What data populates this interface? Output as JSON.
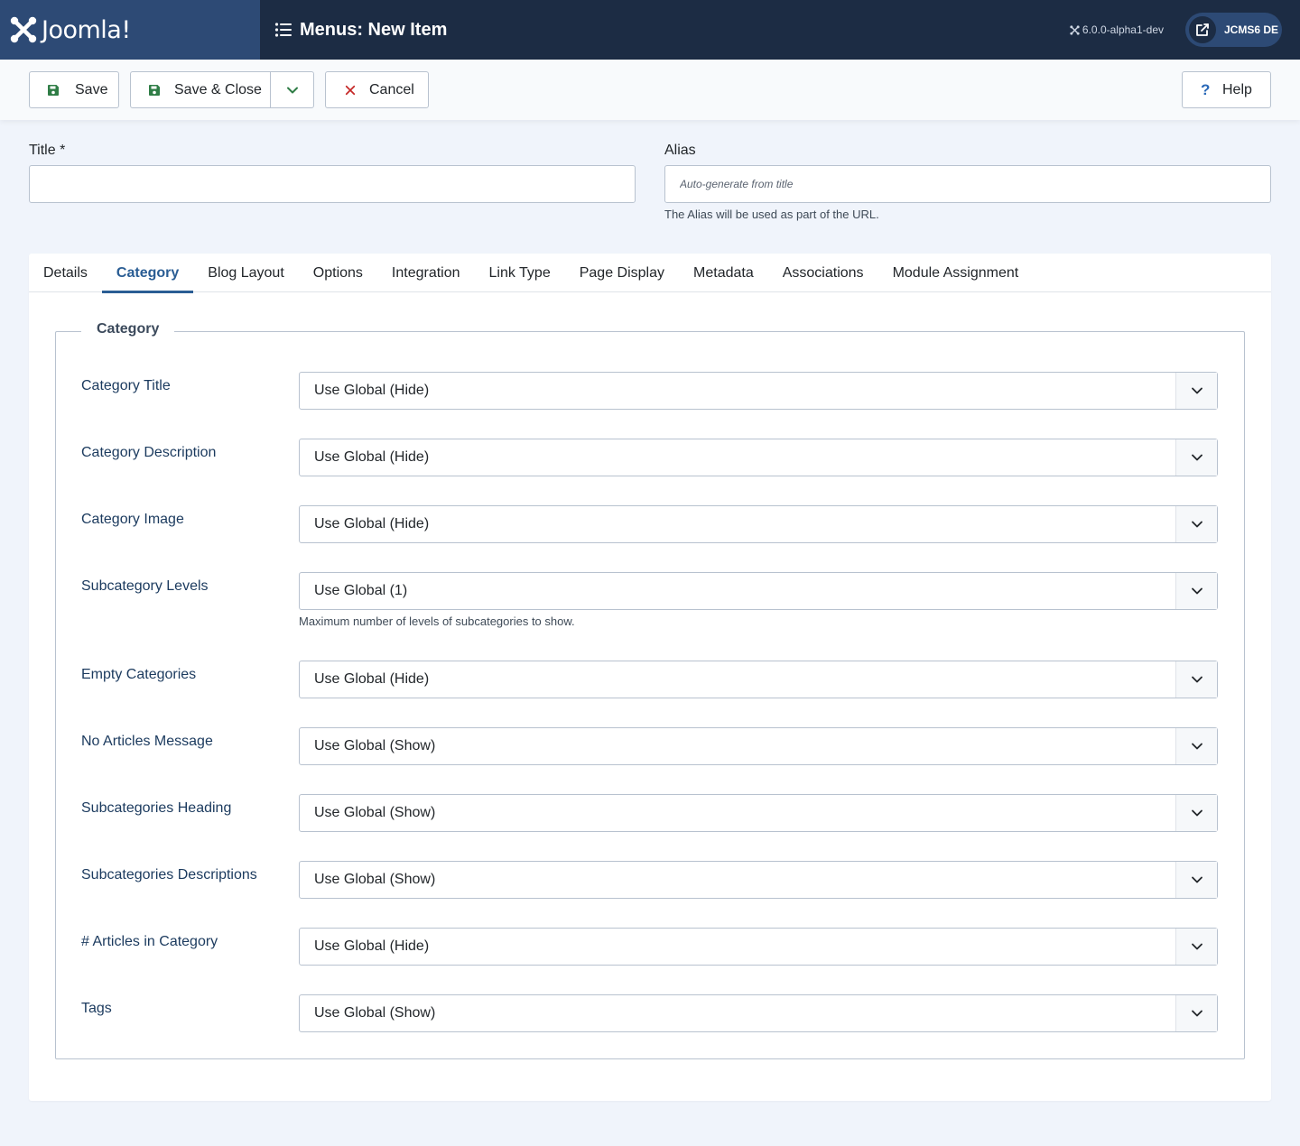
{
  "header": {
    "logo_text": "Joomla!",
    "page_title": "Menus: New Item",
    "version": "6.0.0-alpha1-dev",
    "site_button": "JCMS6 DE"
  },
  "toolbar": {
    "save": "Save",
    "save_close": "Save & Close",
    "cancel": "Cancel",
    "help": "Help",
    "help_glyph": "?"
  },
  "form": {
    "title_label": "Title *",
    "title_value": "",
    "alias_label": "Alias",
    "alias_placeholder": "Auto-generate from title",
    "alias_hint": "The Alias will be used as part of the URL."
  },
  "tabs": [
    {
      "label": "Details"
    },
    {
      "label": "Category",
      "active": true
    },
    {
      "label": "Blog Layout"
    },
    {
      "label": "Options"
    },
    {
      "label": "Integration"
    },
    {
      "label": "Link Type"
    },
    {
      "label": "Page Display"
    },
    {
      "label": "Metadata"
    },
    {
      "label": "Associations"
    },
    {
      "label": "Module Assignment"
    }
  ],
  "category_panel": {
    "legend": "Category",
    "fields": [
      {
        "label": "Category Title",
        "value": "Use Global (Hide)"
      },
      {
        "label": "Category Description",
        "value": "Use Global (Hide)"
      },
      {
        "label": "Category Image",
        "value": "Use Global (Hide)"
      },
      {
        "label": "Subcategory Levels",
        "value": "Use Global (1)",
        "hint": "Maximum number of levels of subcategories to show."
      },
      {
        "label": "Empty Categories",
        "value": "Use Global (Hide)"
      },
      {
        "label": "No Articles Message",
        "value": "Use Global (Show)"
      },
      {
        "label": "Subcategories Heading",
        "value": "Use Global (Show)"
      },
      {
        "label": "Subcategories Descriptions",
        "value": "Use Global (Show)"
      },
      {
        "label": "# Articles in Category",
        "value": "Use Global (Hide)"
      },
      {
        "label": "Tags",
        "value": "Use Global (Show)"
      }
    ]
  },
  "colors": {
    "header_bg": "#1c2c44",
    "logo_bg": "#2d4a75",
    "accent": "#2a5d94",
    "save_icon": "#2f7d46",
    "cancel_icon": "#c52827"
  },
  "icons": {
    "logo": "joomla-logo-icon",
    "menu": "list-icon",
    "version": "joomla-small-icon",
    "site": "external-link-icon",
    "save": "floppy-disk-icon",
    "dropdown": "chevron-down-icon",
    "cancel": "close-icon",
    "help": "question-icon"
  }
}
